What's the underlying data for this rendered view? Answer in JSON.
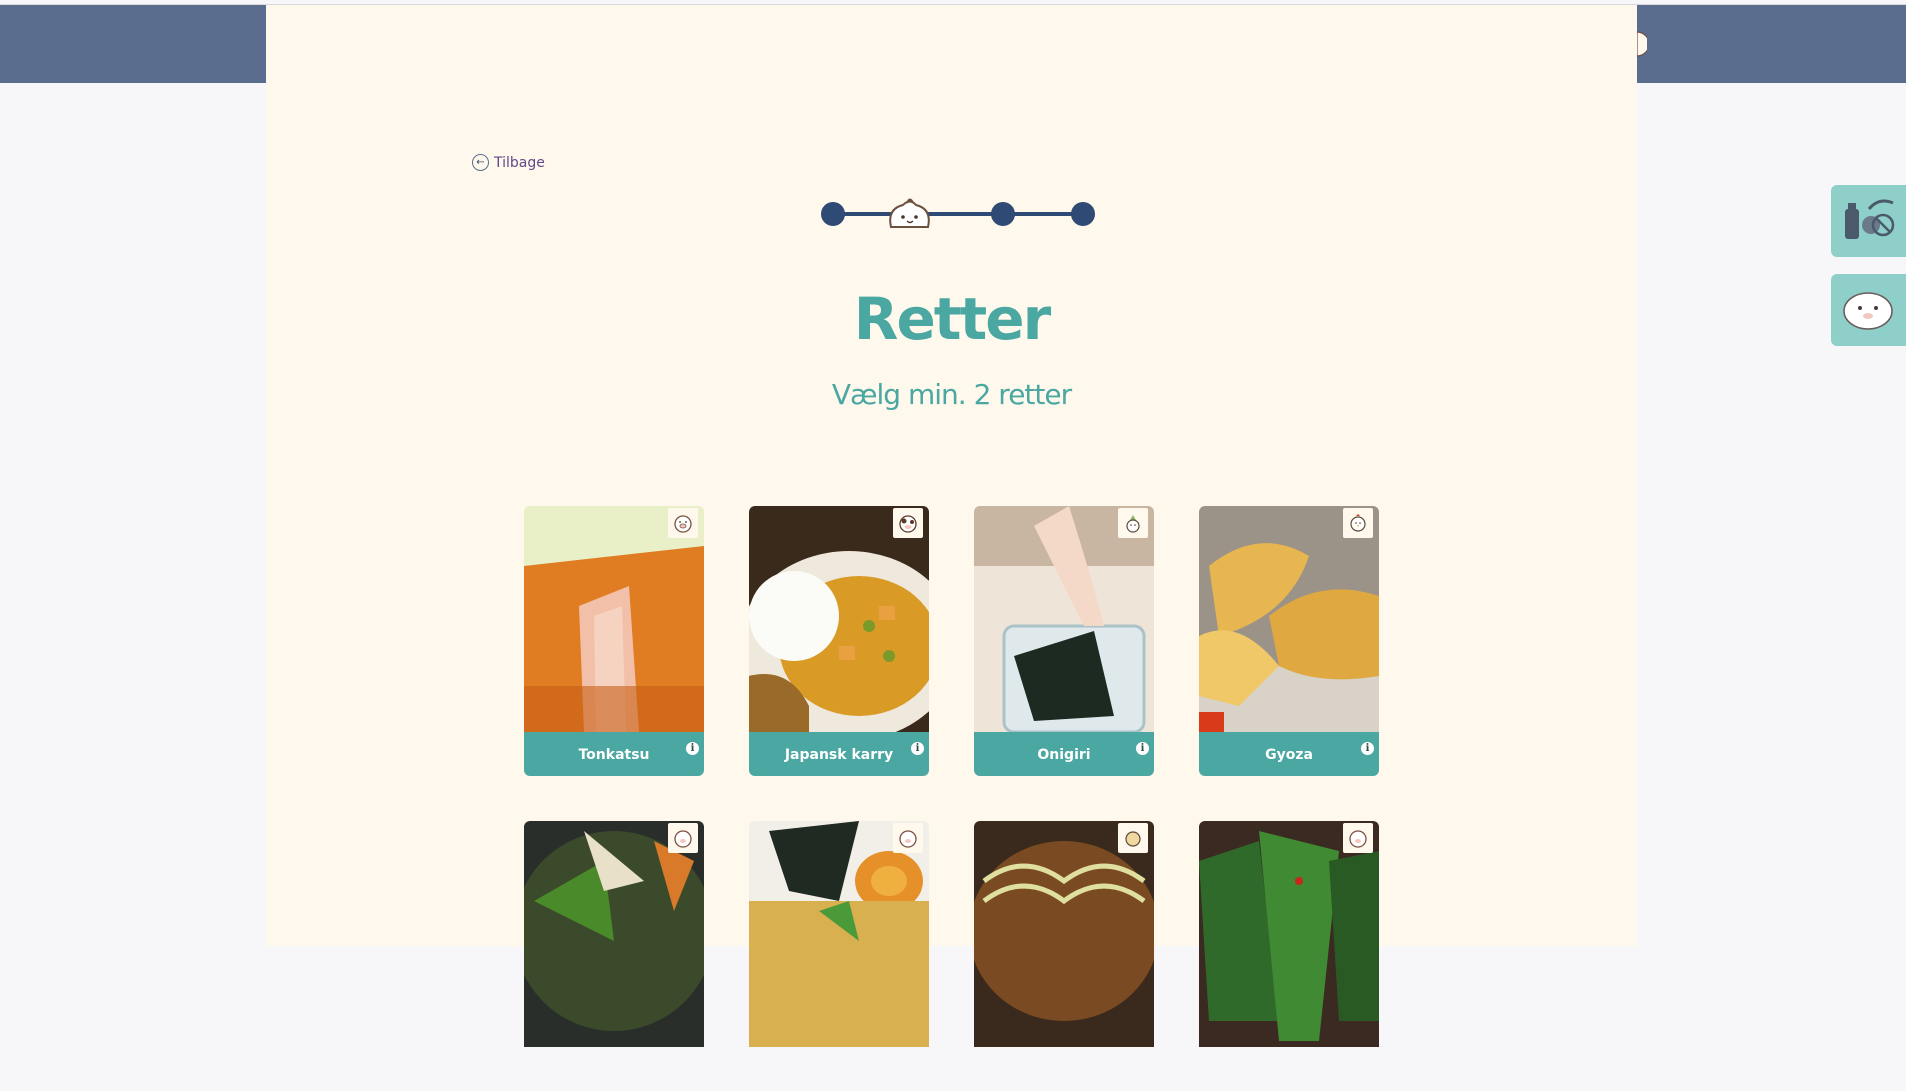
{
  "nav": {
    "back_label": "Tilbage"
  },
  "page": {
    "title": "Retter",
    "subtitle": "Vælg min. 2 retter"
  },
  "stepper": {
    "steps": 4,
    "current": 2
  },
  "dishes_row1": [
    {
      "name": "Tonkatsu"
    },
    {
      "name": "Japansk karry"
    },
    {
      "name": "Onigiri"
    },
    {
      "name": "Gyoza"
    }
  ],
  "info_icon": "i",
  "colors": {
    "accent": "#4ba7a1",
    "header": "#5b6d8f",
    "panel": "#fff8ec",
    "side": "#8fcfca"
  }
}
